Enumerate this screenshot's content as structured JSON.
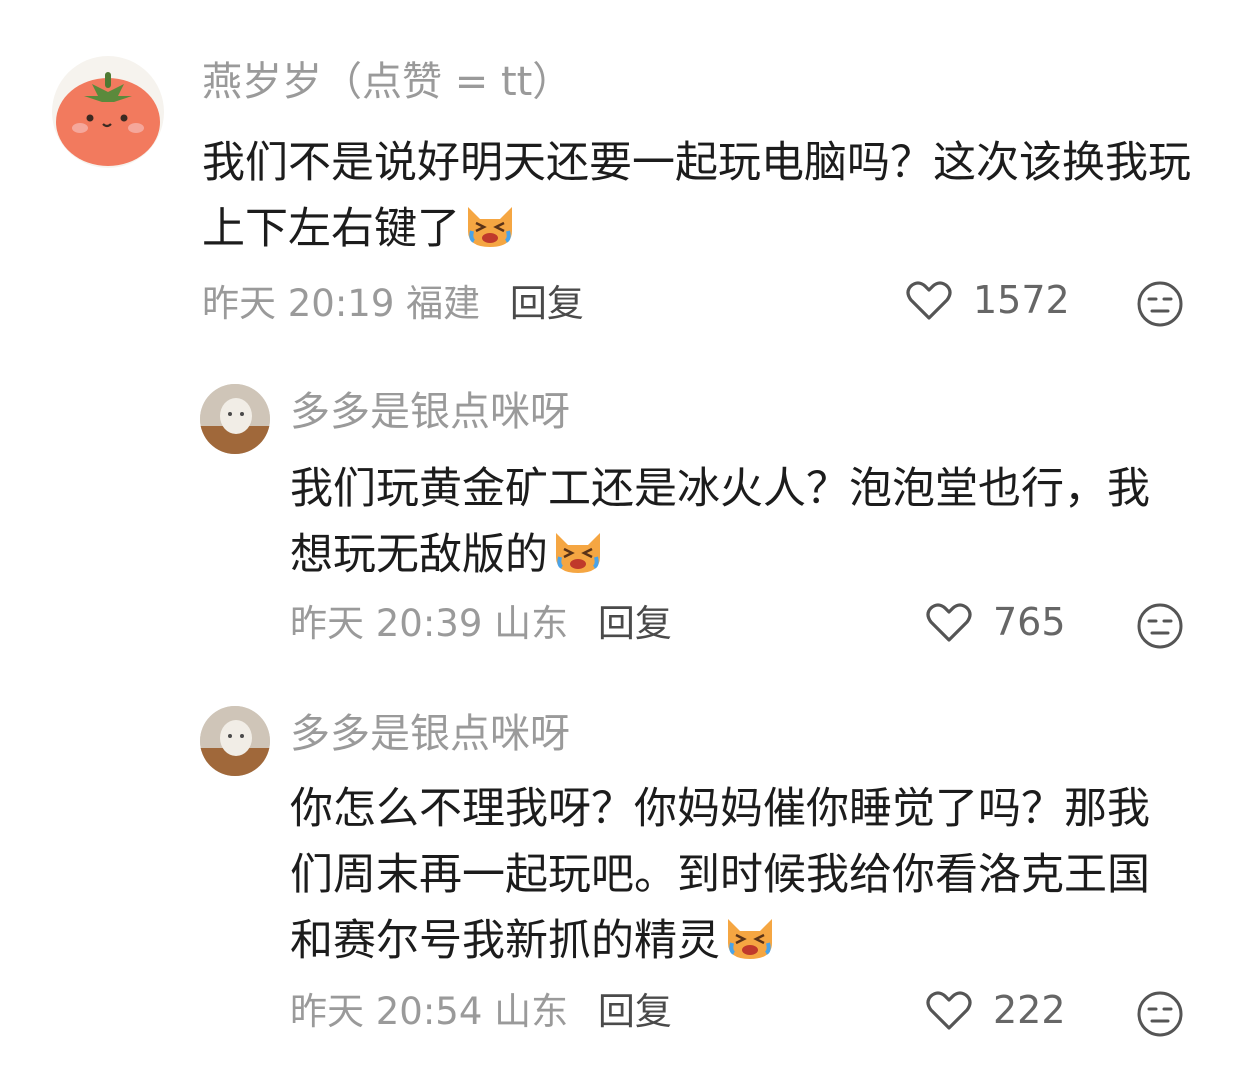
{
  "comments": [
    {
      "username": "燕岁岁（点赞 = tt）",
      "text": "我们不是说好明天还要一起玩电脑吗？这次该换我玩上下左右键了",
      "time": "昨天 20:19",
      "location": "福建",
      "reply_label": "回复",
      "likes": "1572",
      "avatar_icon": "tomato-avatar-icon",
      "emoji_icon": "crying-cat-emoji-icon"
    },
    {
      "username": "多多是银点咪呀",
      "text": "我们玩黄金矿工还是冰火人？泡泡堂也行，我想玩无敌版的",
      "time": "昨天 20:39",
      "location": "山东",
      "reply_label": "回复",
      "likes": "765",
      "avatar_icon": "cat-in-box-avatar-icon",
      "emoji_icon": "crying-cat-emoji-icon"
    },
    {
      "username": "多多是银点咪呀",
      "text": "你怎么不理我呀？你妈妈催你睡觉了吗？那我们周末再一起玩吧。到时候我给你看洛克王国和赛尔号我新抓的精灵",
      "time": "昨天 20:54",
      "location": "山东",
      "reply_label": "回复",
      "likes": "222",
      "avatar_icon": "cat-in-box-avatar-icon",
      "emoji_icon": "crying-cat-emoji-icon"
    }
  ],
  "colors": {
    "username": "#9a9a9a",
    "text": "#1c1c1c",
    "meta": "#9a9a9a",
    "reply": "#4a4a4a"
  }
}
